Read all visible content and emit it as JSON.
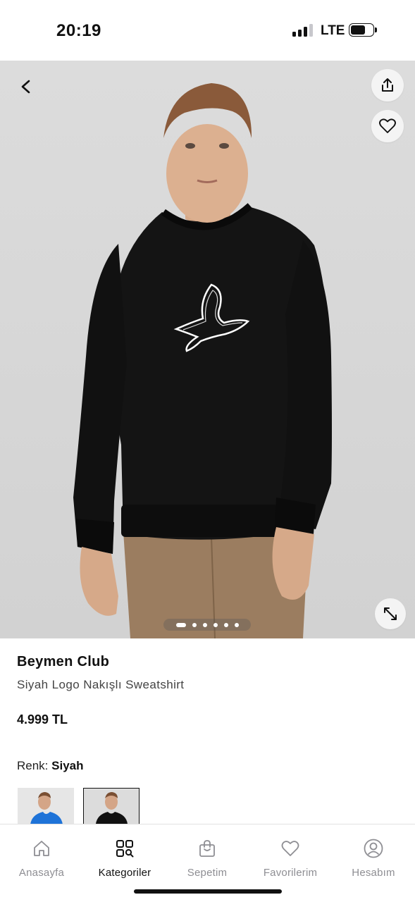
{
  "status_bar": {
    "time": "20:19",
    "network": "LTE",
    "battery_level": 0.7
  },
  "product": {
    "brand": "Beymen Club",
    "name": "Siyah Logo Nakışlı Sweatshirt",
    "price": "4.999 TL",
    "color_label": "Renk:",
    "color_value": "Siyah",
    "gallery": {
      "image_count": 6,
      "active_index": 0
    },
    "swatches": [
      {
        "color": "#1e73d8",
        "selected": false
      },
      {
        "color": "#111111",
        "selected": true
      }
    ]
  },
  "icons": {
    "back": "chevron-left-icon",
    "share": "share-icon",
    "favorite": "heart-icon",
    "expand": "expand-icon"
  },
  "bottom_nav": {
    "items": [
      {
        "label": "Anasayfa",
        "icon": "home-icon",
        "active": false
      },
      {
        "label": "Kategoriler",
        "icon": "categories-icon",
        "active": true
      },
      {
        "label": "Sepetim",
        "icon": "bag-icon",
        "active": false
      },
      {
        "label": "Favorilerim",
        "icon": "heart-icon",
        "active": false
      },
      {
        "label": "Hesabım",
        "icon": "account-icon",
        "active": false
      }
    ]
  }
}
